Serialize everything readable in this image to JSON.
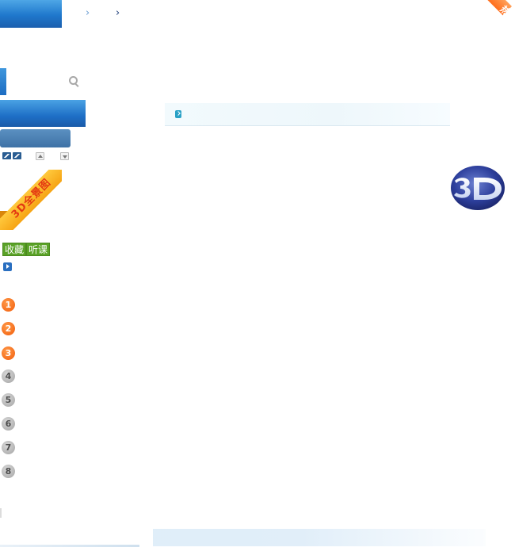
{
  "header": {
    "hot_badge": "热"
  },
  "sidebar": {
    "ribbon_label": "3D全景图",
    "tags": [
      "收藏",
      "听课"
    ],
    "ranking": [
      "1",
      "2",
      "3",
      "4",
      "5",
      "6",
      "7",
      "8"
    ]
  },
  "colors": {
    "brand_blue": "#1f78cc",
    "accent_orange": "#f25c0a",
    "tag_green": "#5aa227",
    "ribbon_yellow": "#f6a414",
    "rank_gray": "#a4a4a4"
  }
}
